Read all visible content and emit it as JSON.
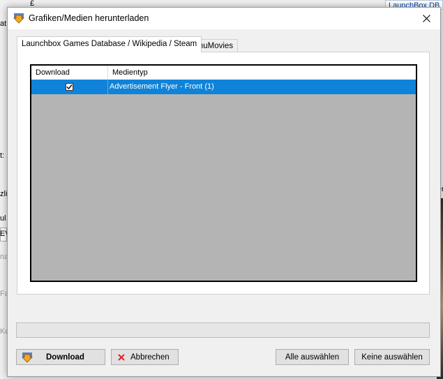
{
  "background": {
    "fragments": [
      "£",
      "at",
      "t:",
      "zli",
      "ul",
      "EV",
      "na",
      "Fa",
      "Ko",
      "er"
    ],
    "link_text": "LaunchBox DB I"
  },
  "dialog": {
    "title": "Grafiken/Medien herunterladen",
    "tabs": [
      {
        "label": "Launchbox Games Database / Wikipedia / Steam",
        "active": true
      },
      {
        "label": "EmuMovies",
        "active": false
      }
    ],
    "grid": {
      "columns": [
        "Download",
        "Medientyp"
      ],
      "rows": [
        {
          "download": true,
          "media_type": "Advertisement Flyer - Front (1)",
          "selected": true
        }
      ]
    },
    "buttons": {
      "download": "Download",
      "cancel": "Abbrechen",
      "select_all": "Alle auswählen",
      "select_none": "Keine auswählen"
    }
  },
  "colors": {
    "selection": "#0f83d9",
    "grid_background": "#b4b4b4",
    "cancel_icon": "#e02020",
    "download_icon": "#f5a623"
  }
}
